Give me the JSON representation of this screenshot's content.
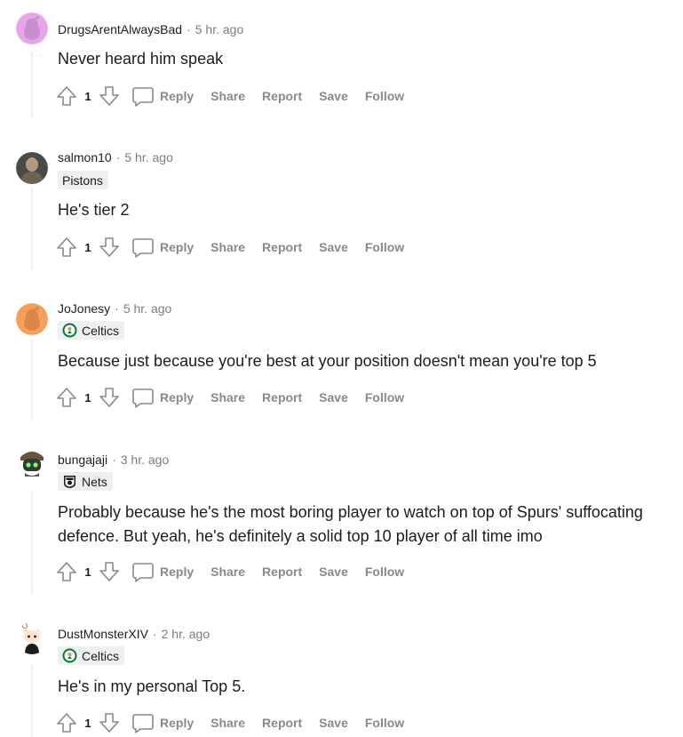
{
  "comments": [
    {
      "author": "DrugsArentAlwaysBad",
      "time": "5 hr. ago",
      "flair": null,
      "body": "Never heard him speak",
      "score": "1"
    },
    {
      "author": "salmon10",
      "time": "5 hr. ago",
      "flair": "Pistons",
      "body": "He's tier 2",
      "score": "1"
    },
    {
      "author": "JoJonesy",
      "time": "5 hr. ago",
      "flair": "Celtics",
      "body": "Because just because you're best at your position doesn't mean you're top 5",
      "score": "1"
    },
    {
      "author": "bungajaji",
      "time": "3 hr. ago",
      "flair": "Nets",
      "body": "Probably because he's the most boring player to watch on top of Spurs' suffocating defence. But yeah, he's definitely a solid top 10 player of all time imo",
      "score": "1"
    },
    {
      "author": "DustMonsterXIV",
      "time": "2 hr. ago",
      "flair": "Celtics",
      "body": "He's in my personal Top 5.",
      "score": "1"
    }
  ],
  "actions": {
    "reply": "Reply",
    "share": "Share",
    "report": "Report",
    "save": "Save",
    "follow": "Follow",
    "separator": "·"
  },
  "icons": {
    "upvote": "upvote-arrow-icon",
    "downvote": "downvote-arrow-icon",
    "reply": "chat-bubble-icon",
    "celtics": "celtics-logo-icon",
    "nets": "nets-logo-icon"
  },
  "colors": {
    "meta_gray": "#7c7c7c",
    "action_gray": "#878a8c",
    "flair_bg": "#edeff1",
    "thread_line": "#edeff1"
  }
}
